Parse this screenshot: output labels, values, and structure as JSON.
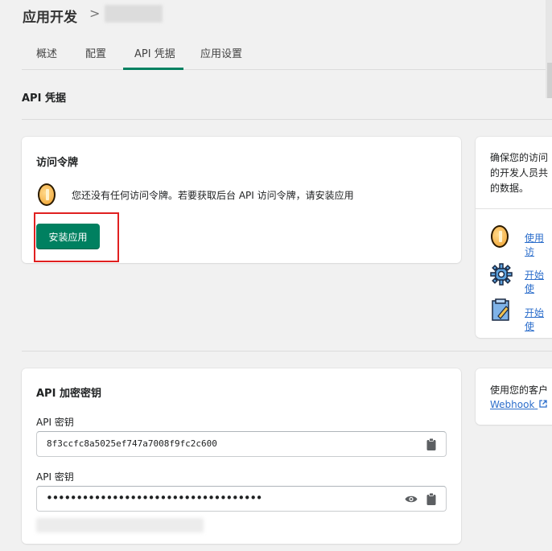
{
  "header": {
    "title": "应用开发",
    "separator": ">"
  },
  "tabs": [
    {
      "label": "概述"
    },
    {
      "label": "配置"
    },
    {
      "label": "API 凭据"
    },
    {
      "label": "应用设置"
    }
  ],
  "section_title": "API 凭据",
  "access_token_card": {
    "title": "访问令牌",
    "message": "您还没有任何访问令牌。若要获取后台 API 访问令牌，请安装应用",
    "install_button": "安装应用"
  },
  "side_card1": {
    "text_lines": [
      "确保您的访问",
      "的开发人员共",
      "的数据。"
    ],
    "links": [
      "使用访",
      "开始使",
      "开始使"
    ]
  },
  "api_keys_card": {
    "title": "API 加密密钥",
    "api_key_label": "API 密钥",
    "api_key_value": "8f3ccfc8a5025ef747a7008f9fc2c600",
    "api_secret_label": "API 密钥",
    "api_secret_value": "••••••••••••••••••••••••••••••••••••"
  },
  "side_card2": {
    "text": "使用您的客户",
    "link": "Webhook"
  },
  "colors": {
    "accent": "#008060",
    "link": "#2c6ecb",
    "highlight": "#e02020"
  }
}
